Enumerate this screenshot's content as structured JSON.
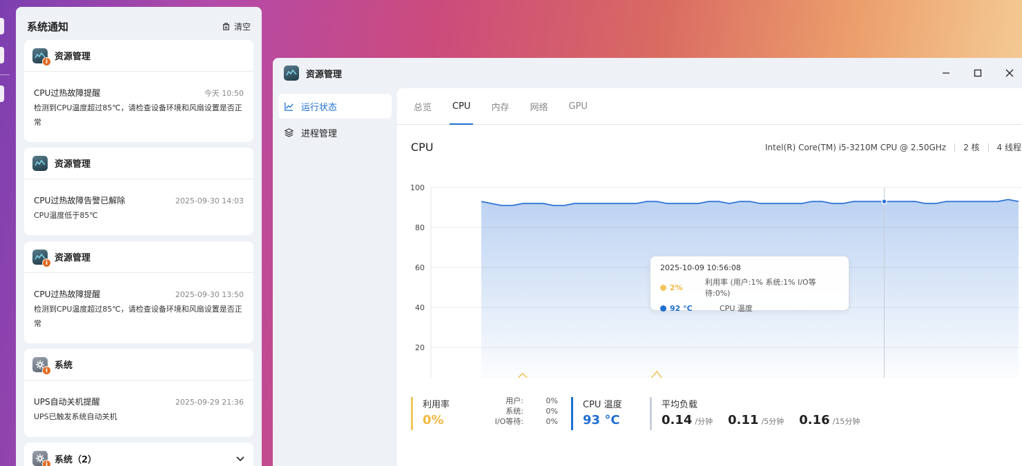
{
  "notifications": {
    "title": "系统通知",
    "clear_label": "清空",
    "items": [
      {
        "app": "资源管理",
        "icon": "resource-monitor-icon",
        "title": "CPU过热故障提醒",
        "time": "今天 10:50",
        "text": "检测到CPU温度超过85℃，请检查设备环境和风扇设置是否正常"
      },
      {
        "app": "资源管理",
        "icon": "resource-monitor-icon",
        "title": "CPU过热故障告警已解除",
        "time": "2025-09-30 14:03",
        "text": "CPU温度低于85℃"
      },
      {
        "app": "资源管理",
        "icon": "resource-monitor-icon",
        "title": "CPU过热故障提醒",
        "time": "2025-09-30 13:50",
        "text": "检测到CPU温度超过85℃，请检查设备环境和风扇设置是否正常"
      },
      {
        "app": "系统",
        "icon": "gear-icon",
        "title": "UPS自动关机提醒",
        "time": "2025-09-29 21:36",
        "text": "UPS已触发系统自动关机"
      }
    ],
    "group": {
      "app": "系统（2）",
      "icon": "gear-icon"
    }
  },
  "window": {
    "title": "资源管理",
    "nav": [
      {
        "label": "运行状态",
        "icon": "line-chart-icon",
        "active": true
      },
      {
        "label": "进程管理",
        "icon": "layers-icon",
        "active": false
      }
    ],
    "tabs": [
      "总览",
      "CPU",
      "内存",
      "网络",
      "GPU"
    ],
    "active_tab": "CPU"
  },
  "cpu": {
    "title": "CPU",
    "model": "Intel(R) Core(TM) i5-3210M CPU @ 2.50GHz",
    "cores": "2 核",
    "threads": "4 线程"
  },
  "tooltip": {
    "time": "2025-10-09 10:56:08",
    "util_value": "2%",
    "util_label": "利用率 (用户:1% 系统:1% I/O等待:0%)",
    "temp_value": "92 °C",
    "temp_label": "CPU 温度"
  },
  "stats": {
    "util": {
      "label": "利用率",
      "value": "0%",
      "user_k": "用户:",
      "user_v": "0%",
      "sys_k": "系统:",
      "sys_v": "0%",
      "io_k": "I/O等待:",
      "io_v": "0%"
    },
    "temp": {
      "label": "CPU 温度",
      "value": "93 °C"
    },
    "load": {
      "label": "平均负载",
      "v1": "0.14",
      "u1": "/分钟",
      "v5": "0.11",
      "u5": "/5分钟",
      "v15": "0.16",
      "u15": "/15分钟"
    }
  },
  "colors": {
    "accent": "#1f6fd0",
    "util": "#f3b841",
    "temp_line": "#2f74d6"
  },
  "chart_data": {
    "type": "line",
    "y_ticks": [
      100,
      80,
      60,
      40,
      20
    ],
    "ylim": [
      0,
      100
    ],
    "series": [
      {
        "name": "CPU 温度",
        "values": [
          93,
          92,
          91,
          91,
          92,
          92,
          92,
          91,
          91,
          92,
          92,
          92,
          92,
          92,
          92,
          92,
          93,
          93,
          92,
          92,
          92,
          92,
          93,
          93,
          92,
          93,
          93,
          92,
          92,
          92,
          92,
          92,
          93,
          93,
          92,
          92,
          93,
          93,
          93,
          93,
          93,
          93,
          93,
          92,
          92,
          93,
          93,
          93,
          93,
          93,
          93,
          94,
          93
        ]
      },
      {
        "name": "利用率",
        "values": [
          1,
          3,
          3,
          2,
          7,
          2,
          2,
          1,
          1,
          4,
          2,
          1,
          1,
          0,
          1,
          0,
          2,
          8,
          1,
          1,
          1,
          1,
          1,
          0,
          1,
          2,
          1,
          0,
          1,
          1,
          2,
          1,
          0,
          2,
          1,
          0,
          2,
          1,
          2,
          2,
          3,
          1,
          3,
          0,
          2,
          1,
          1,
          2,
          1,
          0,
          2,
          1,
          0
        ]
      }
    ],
    "hover_index": 39
  }
}
